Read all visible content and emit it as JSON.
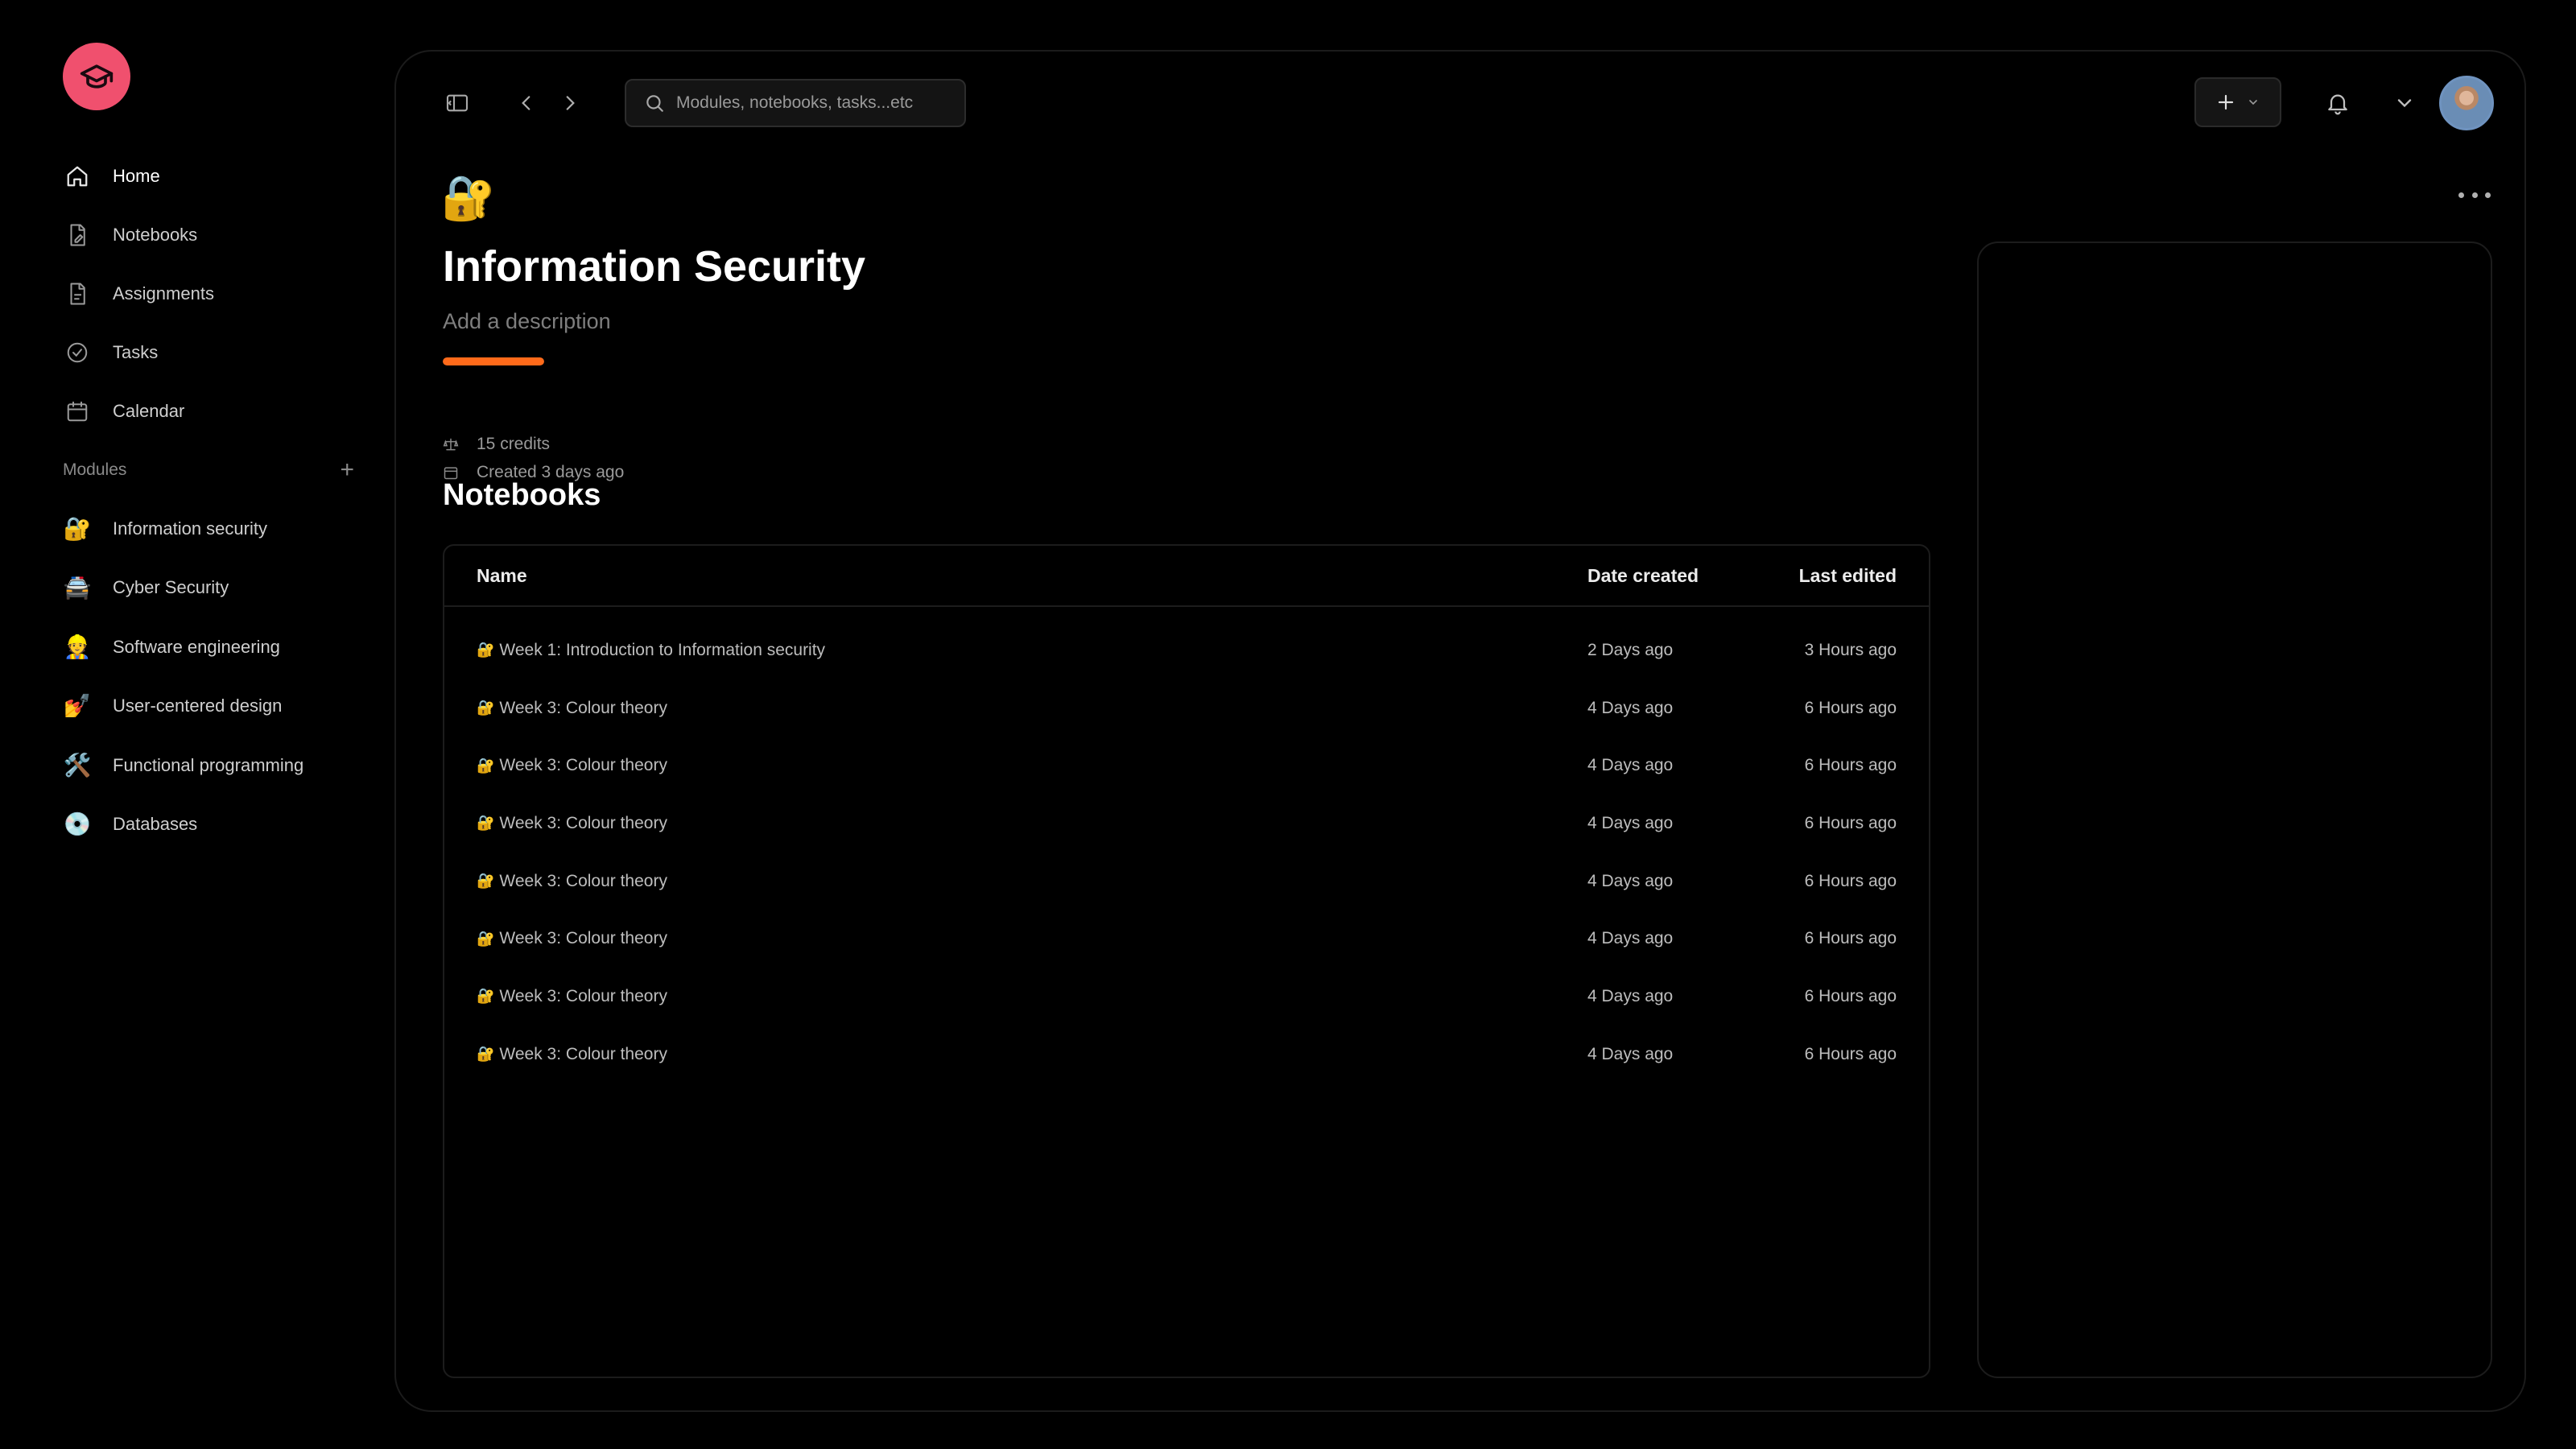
{
  "sidebar": {
    "nav": [
      {
        "label": "Home",
        "icon": "home-icon"
      },
      {
        "label": "Notebooks",
        "icon": "notebook-icon"
      },
      {
        "label": "Assignments",
        "icon": "assignment-icon"
      },
      {
        "label": "Tasks",
        "icon": "check-circle-icon"
      },
      {
        "label": "Calendar",
        "icon": "calendar-icon"
      }
    ],
    "modules_label": "Modules",
    "add_module_label": "+",
    "modules": [
      {
        "emoji": "🔐",
        "label": "Information security"
      },
      {
        "emoji": "🚔",
        "label": "Cyber Security"
      },
      {
        "emoji": "👷",
        "label": "Software engineering"
      },
      {
        "emoji": "💅",
        "label": "User-centered design"
      },
      {
        "emoji": "🛠️",
        "label": "Functional programming"
      },
      {
        "emoji": "💿",
        "label": "Databases"
      }
    ]
  },
  "topbar": {
    "search_placeholder": "Modules, notebooks, tasks...etc",
    "new_label": "+"
  },
  "page": {
    "emoji": "🔐",
    "title": "Information Security",
    "description_placeholder": "Add a description",
    "progress_percent": 12,
    "accent_color": "#ff6a1a",
    "credits": "15 credits",
    "created": "Created 3 days ago"
  },
  "notebooks": {
    "section_title": "Notebooks",
    "columns": {
      "name": "Name",
      "date_created": "Date created",
      "last_edited": "Last edited"
    },
    "rows": [
      {
        "emoji": "🔐",
        "name": "Week 1: Introduction to Information security",
        "date_created": "2 Days ago",
        "last_edited": "3 Hours ago"
      },
      {
        "emoji": "🔐",
        "name": "Week 3: Colour theory",
        "date_created": "4 Days ago",
        "last_edited": "6 Hours ago"
      },
      {
        "emoji": "🔐",
        "name": "Week 3: Colour theory",
        "date_created": "4 Days ago",
        "last_edited": "6 Hours ago"
      },
      {
        "emoji": "🔐",
        "name": "Week 3: Colour theory",
        "date_created": "4 Days ago",
        "last_edited": "6 Hours ago"
      },
      {
        "emoji": "🔐",
        "name": "Week 3: Colour theory",
        "date_created": "4 Days ago",
        "last_edited": "6 Hours ago"
      },
      {
        "emoji": "🔐",
        "name": "Week 3: Colour theory",
        "date_created": "4 Days ago",
        "last_edited": "6 Hours ago"
      },
      {
        "emoji": "🔐",
        "name": "Week 3: Colour theory",
        "date_created": "4 Days ago",
        "last_edited": "6 Hours ago"
      },
      {
        "emoji": "🔐",
        "name": "Week 3: Colour theory",
        "date_created": "4 Days ago",
        "last_edited": "6 Hours ago"
      }
    ]
  },
  "colors": {
    "brand": "#f0506e",
    "accent": "#ff6a1a",
    "background": "#000000"
  }
}
